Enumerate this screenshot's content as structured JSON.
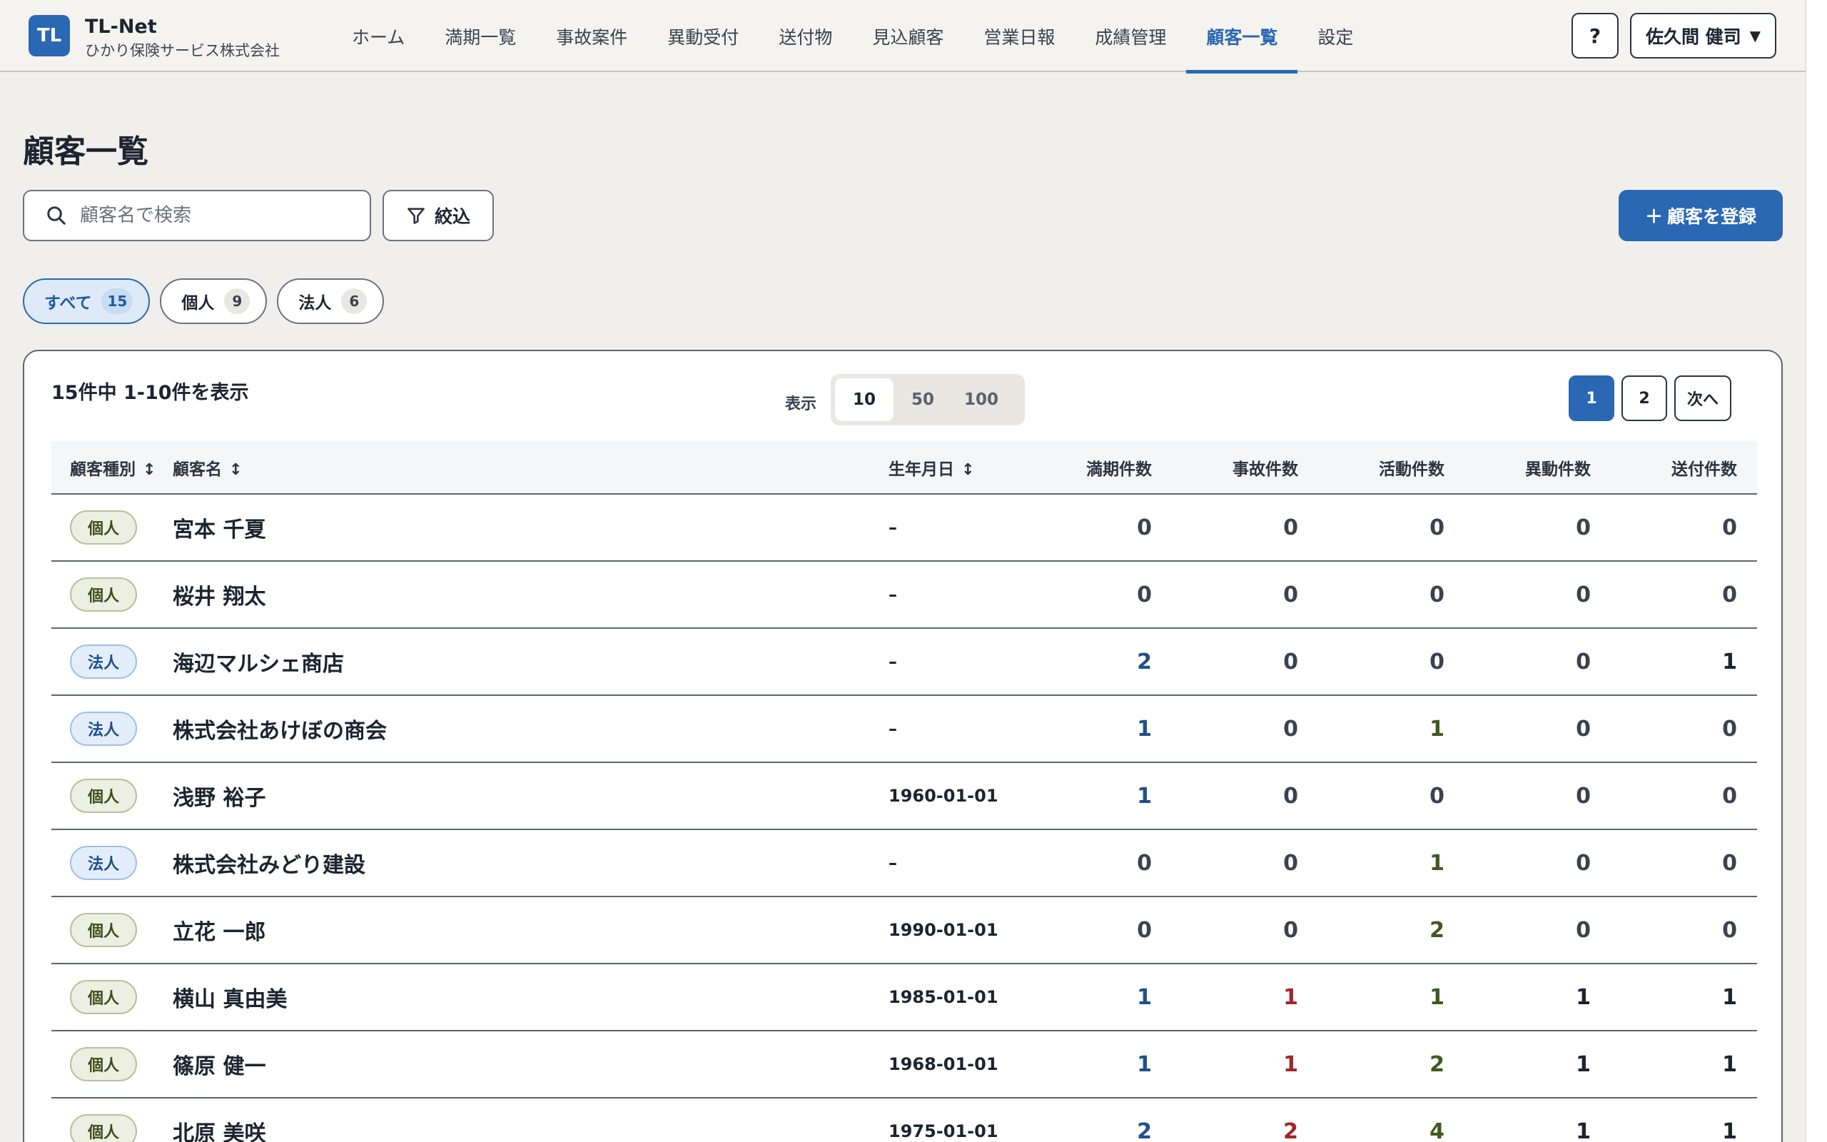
{
  "header": {
    "logo": "TL",
    "brand": "TL-Net",
    "company": "ひかり保険サービス株式会社",
    "nav": [
      {
        "label": "ホーム",
        "active": false
      },
      {
        "label": "満期一覧",
        "active": false
      },
      {
        "label": "事故案件",
        "active": false
      },
      {
        "label": "異動受付",
        "active": false
      },
      {
        "label": "送付物",
        "active": false
      },
      {
        "label": "見込顧客",
        "active": false
      },
      {
        "label": "営業日報",
        "active": false
      },
      {
        "label": "成績管理",
        "active": false
      },
      {
        "label": "顧客一覧",
        "active": true
      },
      {
        "label": "設定",
        "active": false
      }
    ],
    "help_label": "?",
    "user_name": "佐久間 健司"
  },
  "page": {
    "title": "顧客一覧",
    "search_placeholder": "顧客名で検索",
    "filter_label": "絞込",
    "register_label": "顧客を登録"
  },
  "chips": [
    {
      "label": "すべて",
      "count": "15",
      "active": true
    },
    {
      "label": "個人",
      "count": "9",
      "active": false
    },
    {
      "label": "法人",
      "count": "6",
      "active": false
    }
  ],
  "list": {
    "summary": "15件中 1-10件を表示",
    "per_page_label": "表示",
    "per_page_options": [
      "10",
      "50",
      "100"
    ],
    "per_page_selected": "10",
    "pages": [
      "1",
      "2"
    ],
    "current_page": "1",
    "next_label": "次へ",
    "columns": {
      "type": "顧客種別",
      "name": "顧客名",
      "dob": "生年月日",
      "maturity": "満期件数",
      "accident": "事故件数",
      "activity": "活動件数",
      "transfer": "異動件数",
      "shipment": "送付件数"
    },
    "rows": [
      {
        "type": "個人",
        "name": "宮本 千夏",
        "dob": "–",
        "maturity": "0",
        "accident": "0",
        "activity": "0",
        "transfer": "0",
        "shipment": "0"
      },
      {
        "type": "個人",
        "name": "桜井 翔太",
        "dob": "–",
        "maturity": "0",
        "accident": "0",
        "activity": "0",
        "transfer": "0",
        "shipment": "0"
      },
      {
        "type": "法人",
        "name": "海辺マルシェ商店",
        "dob": "–",
        "maturity": "2",
        "accident": "0",
        "activity": "0",
        "transfer": "0",
        "shipment": "1"
      },
      {
        "type": "法人",
        "name": "株式会社あけぼの商会",
        "dob": "–",
        "maturity": "1",
        "accident": "0",
        "activity": "1",
        "transfer": "0",
        "shipment": "0"
      },
      {
        "type": "個人",
        "name": "浅野 裕子",
        "dob": "1960-01-01",
        "maturity": "1",
        "accident": "0",
        "activity": "0",
        "transfer": "0",
        "shipment": "0"
      },
      {
        "type": "法人",
        "name": "株式会社みどり建設",
        "dob": "–",
        "maturity": "0",
        "accident": "0",
        "activity": "1",
        "transfer": "0",
        "shipment": "0"
      },
      {
        "type": "個人",
        "name": "立花 一郎",
        "dob": "1990-01-01",
        "maturity": "0",
        "accident": "0",
        "activity": "2",
        "transfer": "0",
        "shipment": "0"
      },
      {
        "type": "個人",
        "name": "横山 真由美",
        "dob": "1985-01-01",
        "maturity": "1",
        "accident": "1",
        "activity": "1",
        "transfer": "1",
        "shipment": "1"
      },
      {
        "type": "個人",
        "name": "篠原 健一",
        "dob": "1968-01-01",
        "maturity": "1",
        "accident": "1",
        "activity": "2",
        "transfer": "1",
        "shipment": "1"
      },
      {
        "type": "個人",
        "name": "北原 美咲",
        "dob": "1975-01-01",
        "maturity": "2",
        "accident": "2",
        "activity": "4",
        "transfer": "1",
        "shipment": "1"
      }
    ]
  },
  "colors": {
    "accent": "#2a68b4",
    "maturity_nonzero": "#1f4f8a",
    "accident_nonzero": "#a4252a",
    "activity_nonzero": "#3e5b1d",
    "other_nonzero": "#1c2430"
  }
}
